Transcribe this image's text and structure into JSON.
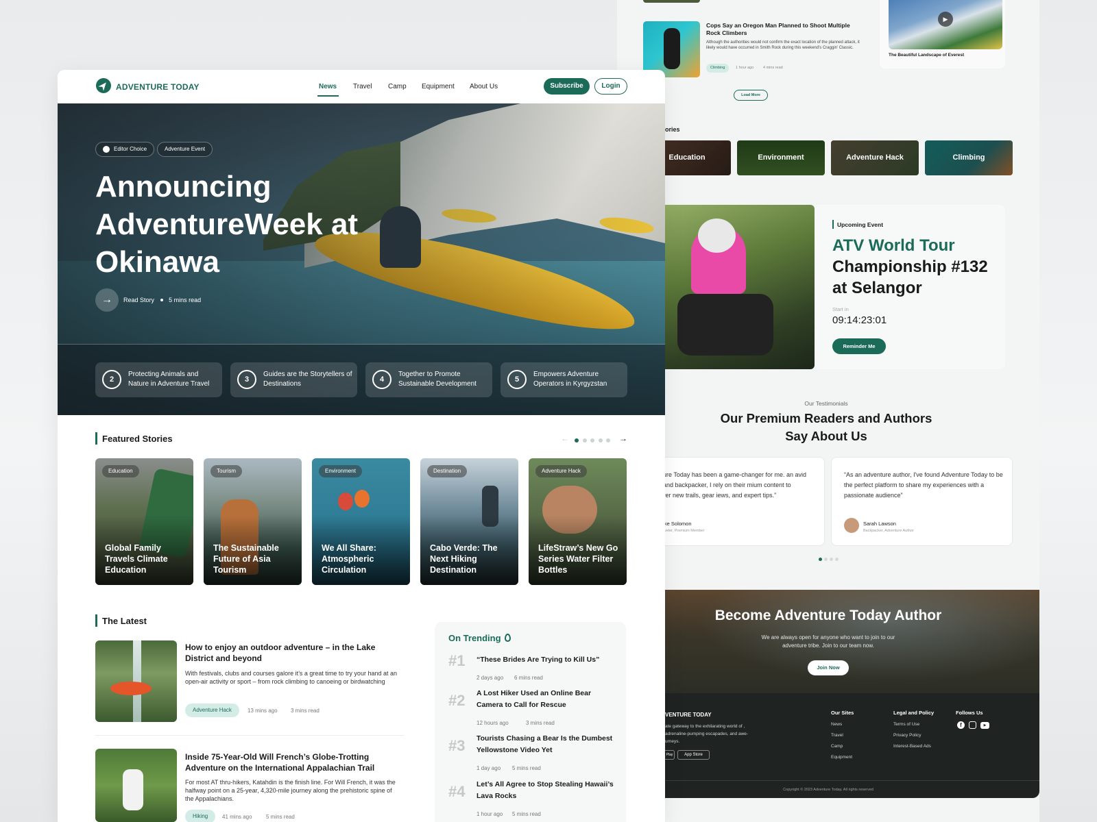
{
  "nav": {
    "brand": "ADVENTURE TODAY",
    "links": [
      "News",
      "Travel",
      "Camp",
      "Equipment",
      "About Us"
    ],
    "subscribe": "Subscribe",
    "login": "Login"
  },
  "hero": {
    "tags": [
      "Editor Choice",
      "Adventure Event"
    ],
    "title": "Announcing AdventureWeek at Okinawa",
    "read_story": "Read Story",
    "read_time": "5 mins read",
    "stories": [
      {
        "num": "2",
        "text": "Protecting Animals and Nature in Adventure Travel"
      },
      {
        "num": "3",
        "text": "Guides are the Storytellers of Destinations"
      },
      {
        "num": "4",
        "text": "Together to Promote Sustainable Development"
      },
      {
        "num": "5",
        "text": "Empowers Adventure Operators in Kyrgyzstan"
      }
    ]
  },
  "featured": {
    "title": "Featured Stories",
    "cards": [
      {
        "category": "Education",
        "title": "Global Family Travels Climate Education"
      },
      {
        "category": "Tourism",
        "title": "The Sustainable Future of Asia Tourism"
      },
      {
        "category": "Environment",
        "title": "We All Share: Atmospheric Circulation"
      },
      {
        "category": "Destination",
        "title": "Cabo Verde: The Next Hiking Destination"
      },
      {
        "category": "Adventure Hack",
        "title": "LifeStraw’s New Go Series Water Filter Bottles"
      }
    ]
  },
  "latest": {
    "title": "The Latest",
    "articles": [
      {
        "title": "How to enjoy an outdoor adventure – in the Lake District and beyond",
        "excerpt": "With festivals, clubs and courses galore it’s a great time to try your hand at an open-air activity or sport – from rock climbing to canoeing or birdwatching",
        "tag": "Adventure Hack",
        "time": "13 mins ago",
        "read": "3 mins read"
      },
      {
        "title": "Inside 75-Year-Old Will French’s Globe-Trotting Adventure on the International Appalachian Trail",
        "excerpt": "For most AT thru-hikers, Katahdin is the finish line. For Will French, it was the halfway point on a 25-year, 4,320-mile journey along the prehistoric spine of the Appalachians.",
        "tag": "Hiking",
        "time": "41 mins ago",
        "read": "5 mins read"
      }
    ]
  },
  "trending": {
    "title": "On Trending",
    "items": [
      {
        "rank": "#1",
        "title": "“These Brides Are Trying to Kill Us”",
        "time": "2 days ago",
        "read": "6 mins read"
      },
      {
        "rank": "#2",
        "title": "A Lost Hiker Used an Online Bear Camera to Call for Rescue",
        "time": "12 hours ago",
        "read": "3 mins read"
      },
      {
        "rank": "#3",
        "title": "Tourists Chasing a Bear Is the Dumbest Yellowstone Video Yet",
        "time": "1 day ago",
        "read": "5 mins read"
      },
      {
        "rank": "#4",
        "title": "Let’s All Agree to Stop Stealing Hawaii’s Lava Rocks",
        "time": "1 hour ago",
        "read": "5 mins read"
      }
    ]
  },
  "back": {
    "news_title": "Cops Say an Oregon Man Planned to Shoot Multiple Rock Climbers",
    "news_excerpt": "Although the authorities would not confirm the exact location of the planned attack, it likely would have occurred in Smith Rock during this weekend’s Craggin’ Classic.",
    "news_tag": "Climbing",
    "news_time": "1 hour ago",
    "news_read": "4 mins read",
    "video_caption": "The Beautiful Landscape of Everest",
    "load_more": "Load More",
    "categories_label": "ories",
    "categories": [
      "Education",
      "Environment",
      "Adventure Hack",
      "Climbing"
    ],
    "event": {
      "label": "Upcoming Event",
      "title_accent": "ATV World Tour",
      "title_rest": "Championship #132 at Selangor",
      "start_label": "Start in",
      "countdown": "09:14:23:01",
      "button": "Reminder Me"
    },
    "testimonials": {
      "label": "Our Testimonials",
      "heading": "Our Premium Readers and Authors Say About Us",
      "items": [
        {
          "quote": "dventure Today has been a game-changer for me. an avid hiker and backpacker, I rely on their mium content to discover new trails, gear iews, and expert tips.”",
          "name": "Mike Solomon",
          "role": "Traveler, Premium Member"
        },
        {
          "quote": "“As an adventure author, I've found Adventure Today to be the perfect platform to share my experiences with a passionate audience”",
          "name": "Sarah Lawson",
          "role": "Backpacker, Adventure Author"
        }
      ]
    },
    "cta": {
      "title": "Become Adventure Today Author",
      "text": "We are always open for anyone who want to join to our adventure tribe. Join to our team now.",
      "button": "Join Now"
    },
    "footer": {
      "brand": "VENTURE TODAY",
      "blurb": "ate gateway to the exhilarating world of , adrenaline-pumping escapades, and awe-urneys.",
      "store_left": "Play",
      "store_right": "App Store",
      "col1_title": "Our Sites",
      "col1": [
        "News",
        "Travel",
        "Camp",
        "Equipment"
      ],
      "col2_title": "Legal and Policy",
      "col2": [
        "Terms of Use",
        "Privacy Policy",
        "Interest-Based Ads"
      ],
      "col3_title": "Follows Us",
      "copyright": "Copyright © 2023 Adventure Today. All rights reserved"
    }
  },
  "colors": {
    "accent": "#1b6b58",
    "chip_bg": "#d3ede6",
    "footer_bg": "#1f2322"
  }
}
